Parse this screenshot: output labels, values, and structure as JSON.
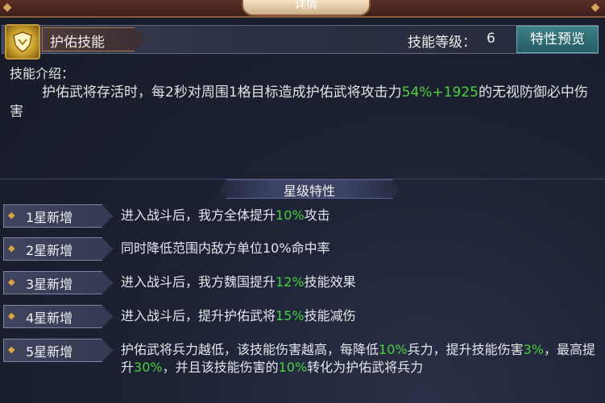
{
  "header": {
    "title": "详情"
  },
  "skill": {
    "name": "护佑技能",
    "level_label": "技能等级：",
    "level_value": "6",
    "preview_button": "特性预览",
    "icon": "shield-icon"
  },
  "intro": {
    "label": "技能介绍：",
    "text_parts": [
      "护佑武将存活时，每2秒对周围1格目标造成护佑武将攻击力",
      "54%+1925",
      "的无视防御必中伤害"
    ]
  },
  "star_section": {
    "title": "星级特性",
    "rows": [
      {
        "tag": "1星新增",
        "parts": [
          "进入战斗后，我方全体提升",
          "10%",
          "攻击"
        ]
      },
      {
        "tag": "2星新增",
        "parts": [
          "同时降低范围内敌方单位10%命中率"
        ]
      },
      {
        "tag": "3星新增",
        "parts": [
          "进入战斗后，我方魏国提升",
          "12%",
          "技能效果"
        ]
      },
      {
        "tag": "4星新增",
        "parts": [
          "进入战斗后，提升护佑武将",
          "15%",
          "技能减伤"
        ]
      },
      {
        "tag": "5星新增",
        "parts": [
          "护佑武将兵力越低，该技能伤害越高，每降低",
          "10%",
          "兵力，提升技能伤害",
          "3%",
          "，最高提升",
          "30%",
          "，并且该技能伤害的",
          "10%",
          "转化为护佑武将兵力"
        ]
      }
    ]
  },
  "colors": {
    "highlight": "#49d23b",
    "accent": "#e2a43a"
  }
}
